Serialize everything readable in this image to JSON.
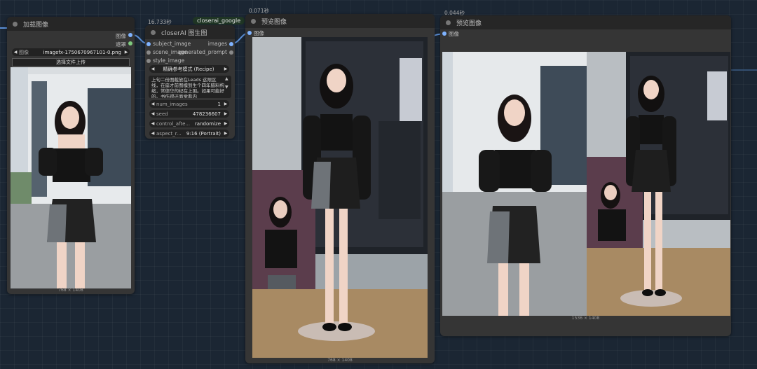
{
  "nodes": {
    "load_image": {
      "title": "加载图像",
      "outputs": [
        "图像",
        "遮罩"
      ],
      "image_widget_label": "图像",
      "image_widget_value": "imagefx-1750670967101-0.png",
      "upload_button": "选择文件上传",
      "dims": "768 × 1408"
    },
    "closerai": {
      "timing": "16.733秒",
      "badge": "closerai_google",
      "title": "closerAI 图生图",
      "inputs": [
        "subject_image",
        "scene_image",
        "style_image"
      ],
      "outputs": [
        "images",
        "generated_prompt"
      ],
      "recipe_value": "精确参考模式 (Recipe)",
      "prompt_text": "上句二份图截放在Leads 这限区线，在座才前图模到生个四年腊料构缩，常德华的纪在上围。如果可能好的。书伤得还面觉看内",
      "widgets": [
        {
          "name": "num_images",
          "value": "1"
        },
        {
          "name": "seed",
          "value": "478236607"
        },
        {
          "name": "control_afte...",
          "value": "randomize"
        },
        {
          "name": "aspect_r...",
          "value": "9:16 (Portrait)"
        }
      ]
    },
    "preview1": {
      "timing": "0.071秒",
      "title": "预览图像",
      "input": "图像",
      "dims": "768 × 1408"
    },
    "preview2": {
      "timing": "0.044秒",
      "title": "预览图像",
      "input": "图像",
      "dims": "1536 × 1408"
    }
  },
  "colors": {
    "canvas": "#1b2633",
    "node_body": "#353535",
    "node_title": "#262626",
    "image_socket": "#7fb3ff",
    "mask_socket": "#7ec97e",
    "badge_bg": "#1f3524"
  },
  "icons": [
    "node-status-dot",
    "arrow-left-icon",
    "arrow-right-icon",
    "scroll-up-icon",
    "scroll-down-icon"
  ]
}
